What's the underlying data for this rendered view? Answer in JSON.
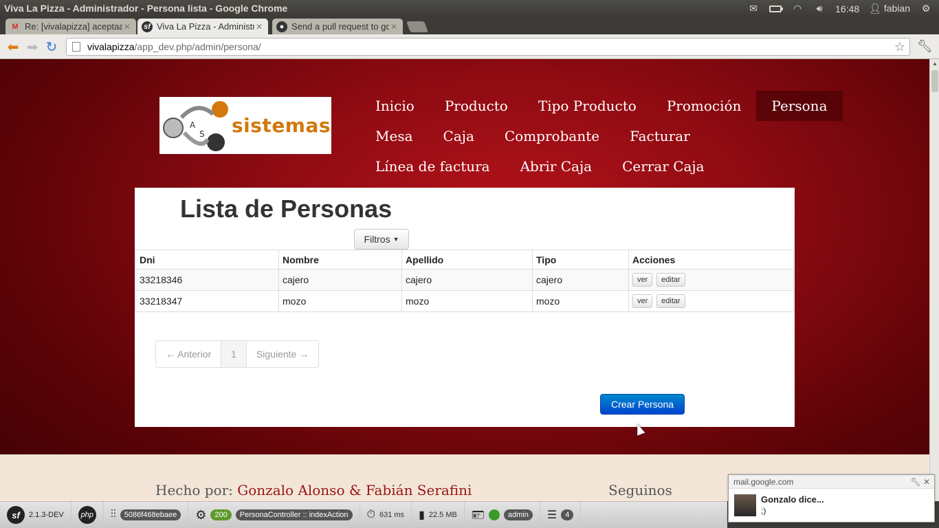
{
  "window": {
    "title": "Viva La Pizza - Administrador - Persona lista - Google Chrome"
  },
  "tray": {
    "time": "16:48",
    "user": "fabian"
  },
  "tabs": [
    {
      "label": "Re: [vivalapizza] aceptaaar",
      "icon": "gmail-icon"
    },
    {
      "label": "Viva La Pizza - Administrac",
      "icon": "symfony-icon"
    },
    {
      "label": "Send a pull request to gon",
      "icon": "github-icon"
    }
  ],
  "address_bar": {
    "host": "vivalapizza",
    "path": "/app_dev.php/admin/persona/"
  },
  "logo": {
    "text": "sistemas"
  },
  "nav": {
    "row1": [
      "Inicio",
      "Producto",
      "Tipo Producto",
      "Promoción",
      "Persona"
    ],
    "row2": [
      "Mesa",
      "Caja",
      "Comprobante",
      "Facturar"
    ],
    "row3": [
      "Línea de factura",
      "Abrir Caja",
      "Cerrar Caja"
    ],
    "active": "Persona"
  },
  "page": {
    "heading": "Lista de Personas",
    "filter_label": "Filtros",
    "table": {
      "headers": [
        "Dni",
        "Nombre",
        "Apellido",
        "Tipo",
        "Acciones"
      ],
      "rows": [
        {
          "dni": "33218346",
          "nombre": "cajero",
          "apellido": "cajero",
          "tipo": "cajero"
        },
        {
          "dni": "33218347",
          "nombre": "mozo",
          "apellido": "mozo",
          "tipo": "mozo"
        }
      ],
      "action_view": "ver",
      "action_edit": "editar"
    },
    "pager": {
      "prev": "← Anterior",
      "current": "1",
      "next": "Siguiente →"
    },
    "create_button": "Crear Persona"
  },
  "footer": {
    "byline_prefix": "Hecho por: ",
    "byline_names": "Gonzalo Alonso & Fabián Serafini",
    "follow": "Seguinos"
  },
  "debug_toolbar": {
    "version": "2.1.3-DEV",
    "token": "5086f468ebaee",
    "status": "200",
    "controller": "PersonaController",
    "action": "indexAction",
    "time": "631 ms",
    "memory": "22.5 MB",
    "user": "admin",
    "queries": "4"
  },
  "notification": {
    "source": "mail.google.com",
    "sender": "Gonzalo dice...",
    "message": ";)"
  }
}
